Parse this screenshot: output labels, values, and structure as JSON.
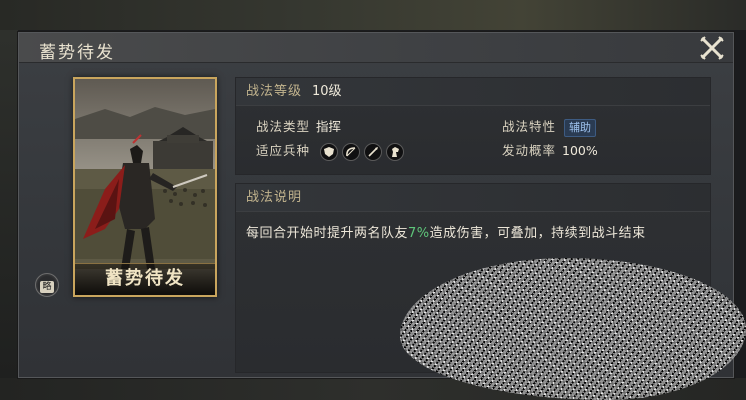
{
  "dialog": {
    "title": "蓄势待发"
  },
  "card": {
    "name": "蓄势待发",
    "badge": "略"
  },
  "skill": {
    "level_label": "战法等级",
    "level_value": "10级",
    "type_label": "战法类型",
    "type_value": "指挥",
    "trait_label": "战法特性",
    "trait_value": "辅助",
    "troops_label": "适应兵种",
    "troops": [
      "shield-icon",
      "bow-icon",
      "spear-icon",
      "horse-icon"
    ],
    "chance_label": "发动概率",
    "chance_value": "100%"
  },
  "description": {
    "header": "战法说明",
    "text_before": "每回合开始时提升两名队友",
    "highlight": "7%",
    "text_after": "造成伤害，可叠加，持续到战斗结束"
  },
  "colors": {
    "accent_gold": "#c9a55d",
    "highlight_green": "#5ec57a",
    "tag_blue": "#9ec2ee"
  }
}
